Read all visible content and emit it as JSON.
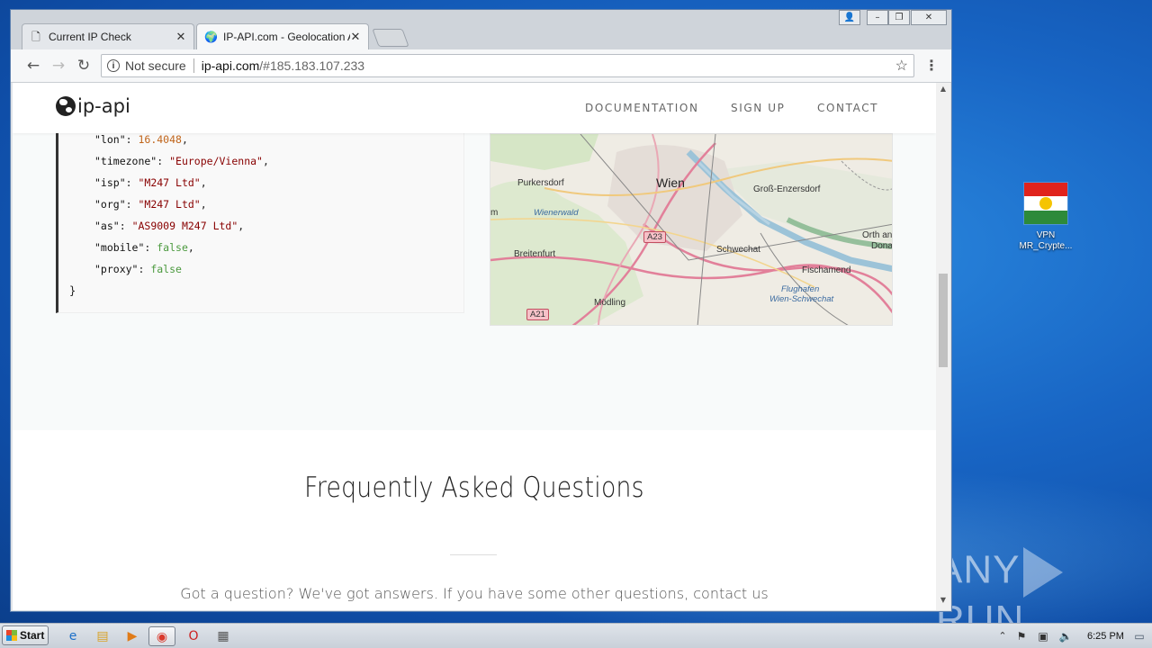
{
  "desktop": {
    "icon_label_line1": "VPN",
    "icon_label_line2": "MR_Crypte...",
    "watermark": "ANY RUN"
  },
  "browser": {
    "tabs": [
      {
        "label": "Current IP Check",
        "icon": "page-icon"
      },
      {
        "label": "IP-API.com - Geolocation AP",
        "icon": "globe-icon"
      }
    ],
    "address": {
      "security": "Not secure",
      "host": "ip-api.com",
      "path": "/#185.183.107.233"
    }
  },
  "site": {
    "logo_text": "ip-api",
    "nav": [
      "DOCUMENTATION",
      "SIGN UP",
      "CONTACT"
    ],
    "json_lines": [
      {
        "key": "\"lon\"",
        "value": "16.4048",
        "type": "num"
      },
      {
        "key": "\"timezone\"",
        "value": "\"Europe/Vienna\"",
        "type": "str"
      },
      {
        "key": "\"isp\"",
        "value": "\"M247 Ltd\"",
        "type": "str"
      },
      {
        "key": "\"org\"",
        "value": "\"M247 Ltd\"",
        "type": "str"
      },
      {
        "key": "\"as\"",
        "value": "\"AS9009 M247 Ltd\"",
        "type": "str"
      },
      {
        "key": "\"mobile\"",
        "value": "false",
        "type": "bool"
      },
      {
        "key": "\"proxy\"",
        "value": "false",
        "type": "bool"
      }
    ],
    "json_close": "}",
    "map_labels": {
      "wien": "Wien",
      "purkersdorf": "Purkersdorf",
      "wienerwald": "Wienerwald",
      "gross_enzersdorf": "Groß-Enzersdorf",
      "orth": "Orth an",
      "dona": "Dona",
      "schwechat": "Schwechat",
      "breitenfurt": "Breitenfurt",
      "fischamend": "Fischamend",
      "flughafen": "Flughafen",
      "wien_schwechat": "Wien-Schwechat",
      "modling": "Mödling",
      "a23": "A23",
      "a21": "A21",
      "m": "m"
    },
    "faq_title": "Frequently Asked Questions",
    "faq_sub": "Got a question? We've got answers. If you have some other questions, contact us"
  },
  "taskbar": {
    "start": "Start",
    "clock": "6:25 PM"
  }
}
